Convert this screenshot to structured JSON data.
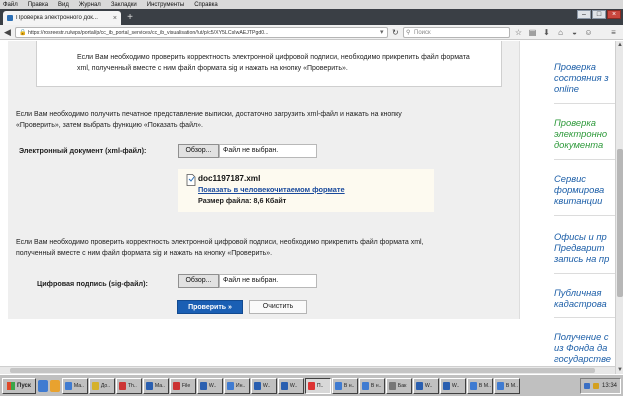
{
  "menu": [
    "Файл",
    "Правка",
    "Вид",
    "Журнал",
    "Закладки",
    "Инструменты",
    "Справка"
  ],
  "tab": {
    "title": "Проверка электронного док..."
  },
  "nav": {
    "url": "https://rosreestr.ru/wps/portal/p/cc_ib_portal_services/cc_ib_visualisation/!ut/p/c5/XY5LCsIwAEJTPgd0...",
    "search_placeholder": "Поиск"
  },
  "top_notice": "Если Вам необходимо проверить корректность электронной цифровой подписи, необходимо прикрепить файл формата xml, полученный вместе с ним файл формата sig и нажать на кнопку «Проверить».",
  "instructions_print": "Если Вам необходимо получить печатное представление выписки, достаточно загрузить xml-файл и нажать на кнопку «Проверить», затем выбрать функцию «Показать файл».",
  "xml_field": {
    "label": "Электронный документ (xml-файл):",
    "browse_label": "Обзор...",
    "value": "Файл не выбран."
  },
  "uploaded_doc": {
    "filename": "doc1197187.xml",
    "show_link": "Показать в человекочитаемом формате",
    "size_text": "Размер файла: 8,6 Кбайт"
  },
  "instructions_sig": "Если Вам необходимо проверить корректность электронной цифровой подписи, необходимо прикрепить файл формата xml, полученный вместе с ним файл формата sig и нажать на кнопку «Проверить».",
  "sig_field": {
    "label": "Цифровая подпись (sig-файл):",
    "browse_label": "Обзор...",
    "value": "Файл не выбран."
  },
  "buttons": {
    "check": "Проверить »",
    "clear": "Очистить"
  },
  "sidebar": {
    "links": [
      {
        "text": "Проверка\nсостояния з\nonline",
        "color": "#1d5fa8"
      },
      {
        "text": "Проверка\nэлектронно\nдокумента",
        "color": "#2e9a3b"
      },
      {
        "text": "Сервис\nформирова\nквитанции",
        "color": "#1d5fa8"
      },
      {
        "text": "Офисы и пр\nПредварит\nзапись на пр",
        "color": "#1d5fa8"
      },
      {
        "text": "Публичная\nкадастрова",
        "color": "#1d5fa8"
      },
      {
        "text": "Получение с\nиз Фонда да\nгосударстве\nкадастровой",
        "color": "#1d5fa8"
      }
    ]
  },
  "taskbar": {
    "start_label": "Пуск",
    "tasks": [
      "Ма..",
      "До..",
      "Th..",
      "Ма..",
      "File",
      "W..",
      "Ин..",
      "W..",
      "W..",
      "П..",
      "В н..",
      "В н..",
      "Бак",
      "W..",
      "W..",
      "В M..",
      "В M.."
    ],
    "active_task_index": 9,
    "clock": "13:34"
  }
}
